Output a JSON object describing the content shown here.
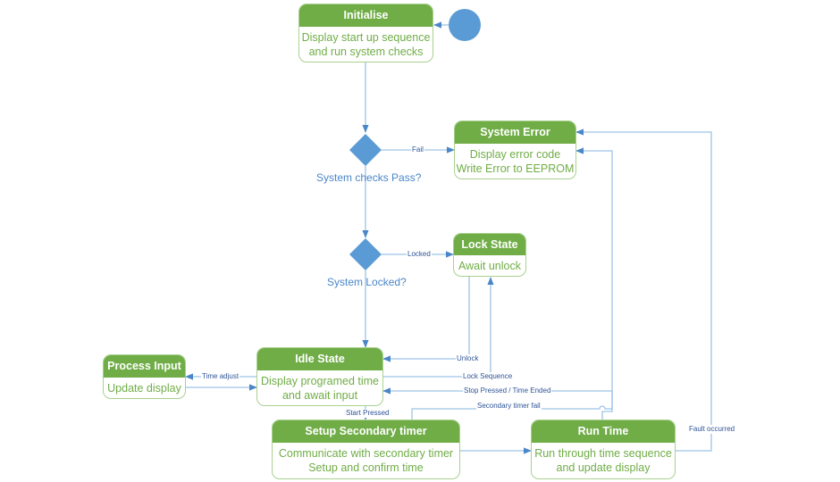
{
  "colors": {
    "header_green": "#70ad47",
    "border_green": "#a9d18e",
    "text_green": "#70ad47",
    "decision_blue": "#5b9bd5",
    "connector_blue": "#9dc3e6",
    "arrow_blue": "#4a86c8",
    "label_blue": "#2f5597"
  },
  "start_node": {
    "shape": "circle"
  },
  "states": {
    "initialise": {
      "title": "Initialise",
      "body": [
        "Display start up sequence",
        "and run system checks"
      ]
    },
    "system_error": {
      "title": "System Error",
      "body": [
        "Display error code",
        "Write Error to EEPROM"
      ]
    },
    "lock_state": {
      "title": "Lock State",
      "body": [
        "Await unlock"
      ]
    },
    "process_input": {
      "title": "Process Input",
      "body": [
        "Update display"
      ]
    },
    "idle_state": {
      "title": "Idle State",
      "body": [
        "Display programed time",
        "and await input"
      ]
    },
    "setup_secondary": {
      "title": "Setup Secondary timer",
      "body": [
        "Communicate with secondary timer",
        "Setup and confirm time"
      ]
    },
    "run_time": {
      "title": "Run Time",
      "body": [
        "Run through time sequence",
        "and update display"
      ]
    }
  },
  "decisions": {
    "system_checks": {
      "label": "System checks Pass?"
    },
    "system_locked": {
      "label": "System Locked?"
    }
  },
  "transitions": {
    "fail": "Fail",
    "locked": "Locked",
    "unlock": "Unlock",
    "lock_sequence": "Lock Sequence",
    "time_adjust": "Time adjust",
    "stop_pressed": "Stop Pressed / Time Ended",
    "secondary_fail": "Secondary timer fail",
    "start_pressed": "Start Pressed",
    "fault_occurred": "Fault occurred"
  }
}
